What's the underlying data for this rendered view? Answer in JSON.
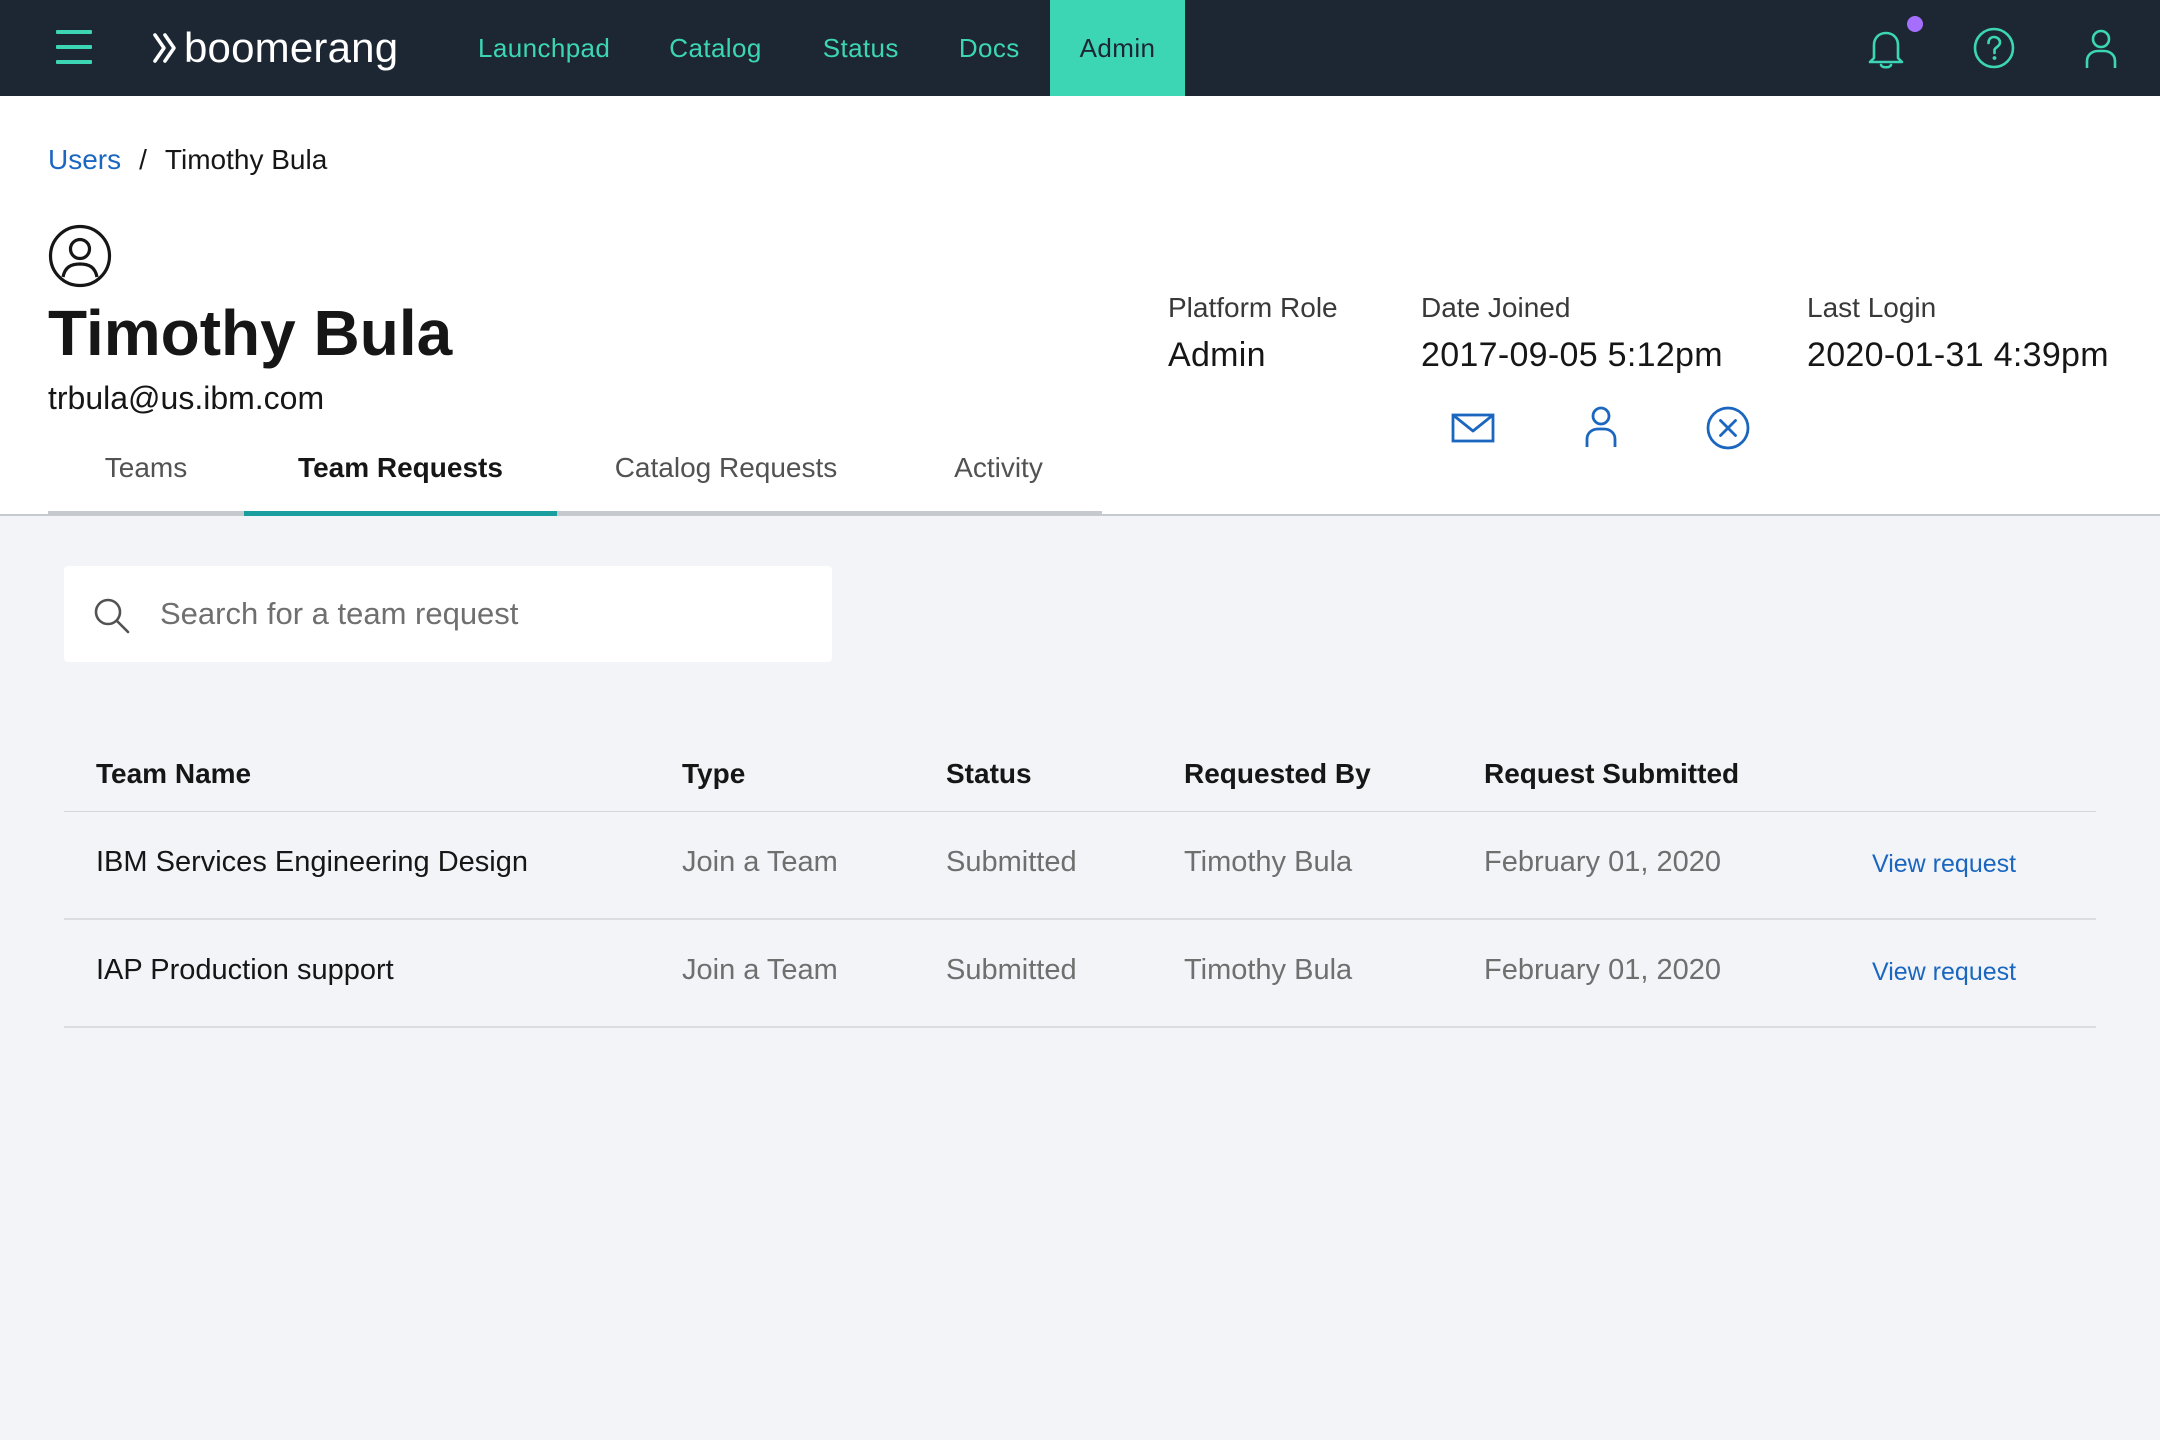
{
  "header": {
    "brand": "boomerang",
    "nav": [
      {
        "label": "Launchpad"
      },
      {
        "label": "Catalog"
      },
      {
        "label": "Status"
      },
      {
        "label": "Docs"
      },
      {
        "label": "Admin",
        "active": true
      }
    ],
    "icons": [
      "menu-icon",
      "bell-icon",
      "help-icon",
      "user-icon"
    ],
    "accent": "#3dd6b5",
    "bg": "#1c2733",
    "notification_dot": "#a56eff"
  },
  "breadcrumb": {
    "parent": "Users",
    "separator": "/",
    "current": "Timothy Bula"
  },
  "profile": {
    "name": "Timothy Bula",
    "email": "trbula@us.ibm.com",
    "platform_role_label": "Platform Role",
    "platform_role": "Admin",
    "date_joined_label": "Date Joined",
    "date_joined": "2017-09-05 5:12pm",
    "last_login_label": "Last Login",
    "last_login": "2020-01-31 4:39pm"
  },
  "tabs": [
    {
      "label": "Teams"
    },
    {
      "label": "Team Requests",
      "active": true
    },
    {
      "label": "Catalog Requests"
    },
    {
      "label": "Activity"
    }
  ],
  "search": {
    "placeholder": "Search for a team request",
    "value": ""
  },
  "table": {
    "columns": [
      "Team Name",
      "Type",
      "Status",
      "Requested By",
      "Request Submitted"
    ],
    "rows": [
      {
        "team": "IBM Services Engineering Design",
        "type": "Join a Team",
        "status": "Submitted",
        "requested_by": "Timothy Bula",
        "submitted": "February 01, 2020",
        "action": "View request"
      },
      {
        "team": "IAP Production support",
        "type": "Join a Team",
        "status": "Submitted",
        "requested_by": "Timothy Bula",
        "submitted": "February 01, 2020",
        "action": "View request"
      }
    ]
  }
}
